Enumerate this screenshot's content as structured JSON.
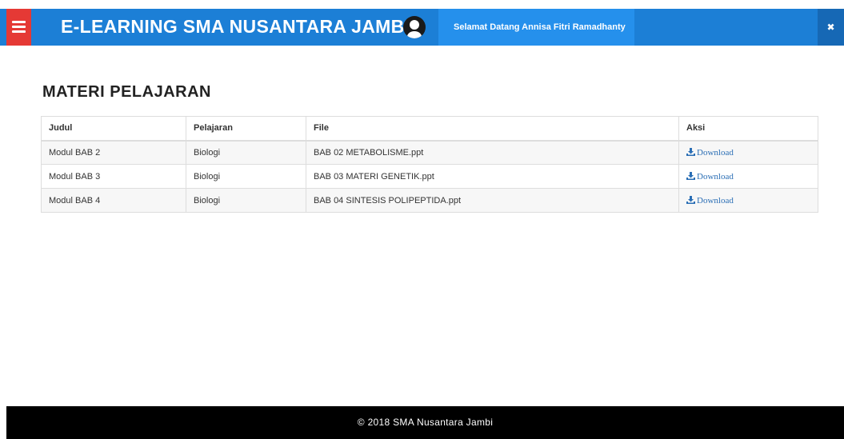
{
  "header": {
    "brand": "E-LEARNING SMA NUSANTARA JAMBI",
    "welcome": "Selamat Datang Annisa Fitri Ramadhanty",
    "close_glyph": "✖",
    "menu_icon": "hamburger-icon",
    "avatar_icon": "user-avatar-icon",
    "colors": {
      "bar": "#1c7fd6",
      "menu": "#e53935",
      "welcome_bg": "#2590ec"
    }
  },
  "main": {
    "title": "MATERI PELAJARAN",
    "table": {
      "headers": {
        "judul": "Judul",
        "pelajaran": "Pelajaran",
        "file": "File",
        "aksi": "Aksi"
      },
      "rows": [
        {
          "judul": "Modul BAB 2",
          "pelajaran": "Biologi",
          "file": "BAB 02 METABOLISME.ppt",
          "aksi": "Download"
        },
        {
          "judul": "Modul BAB 3",
          "pelajaran": "Biologi",
          "file": "BAB 03 MATERI GENETIK.ppt",
          "aksi": "Download"
        },
        {
          "judul": "Modul BAB 4",
          "pelajaran": "Biologi",
          "file": "BAB 04 SINTESIS POLIPEPTIDA.ppt",
          "aksi": "Download"
        }
      ]
    }
  },
  "footer": {
    "text": "© 2018 SMA Nusantara Jambi"
  }
}
